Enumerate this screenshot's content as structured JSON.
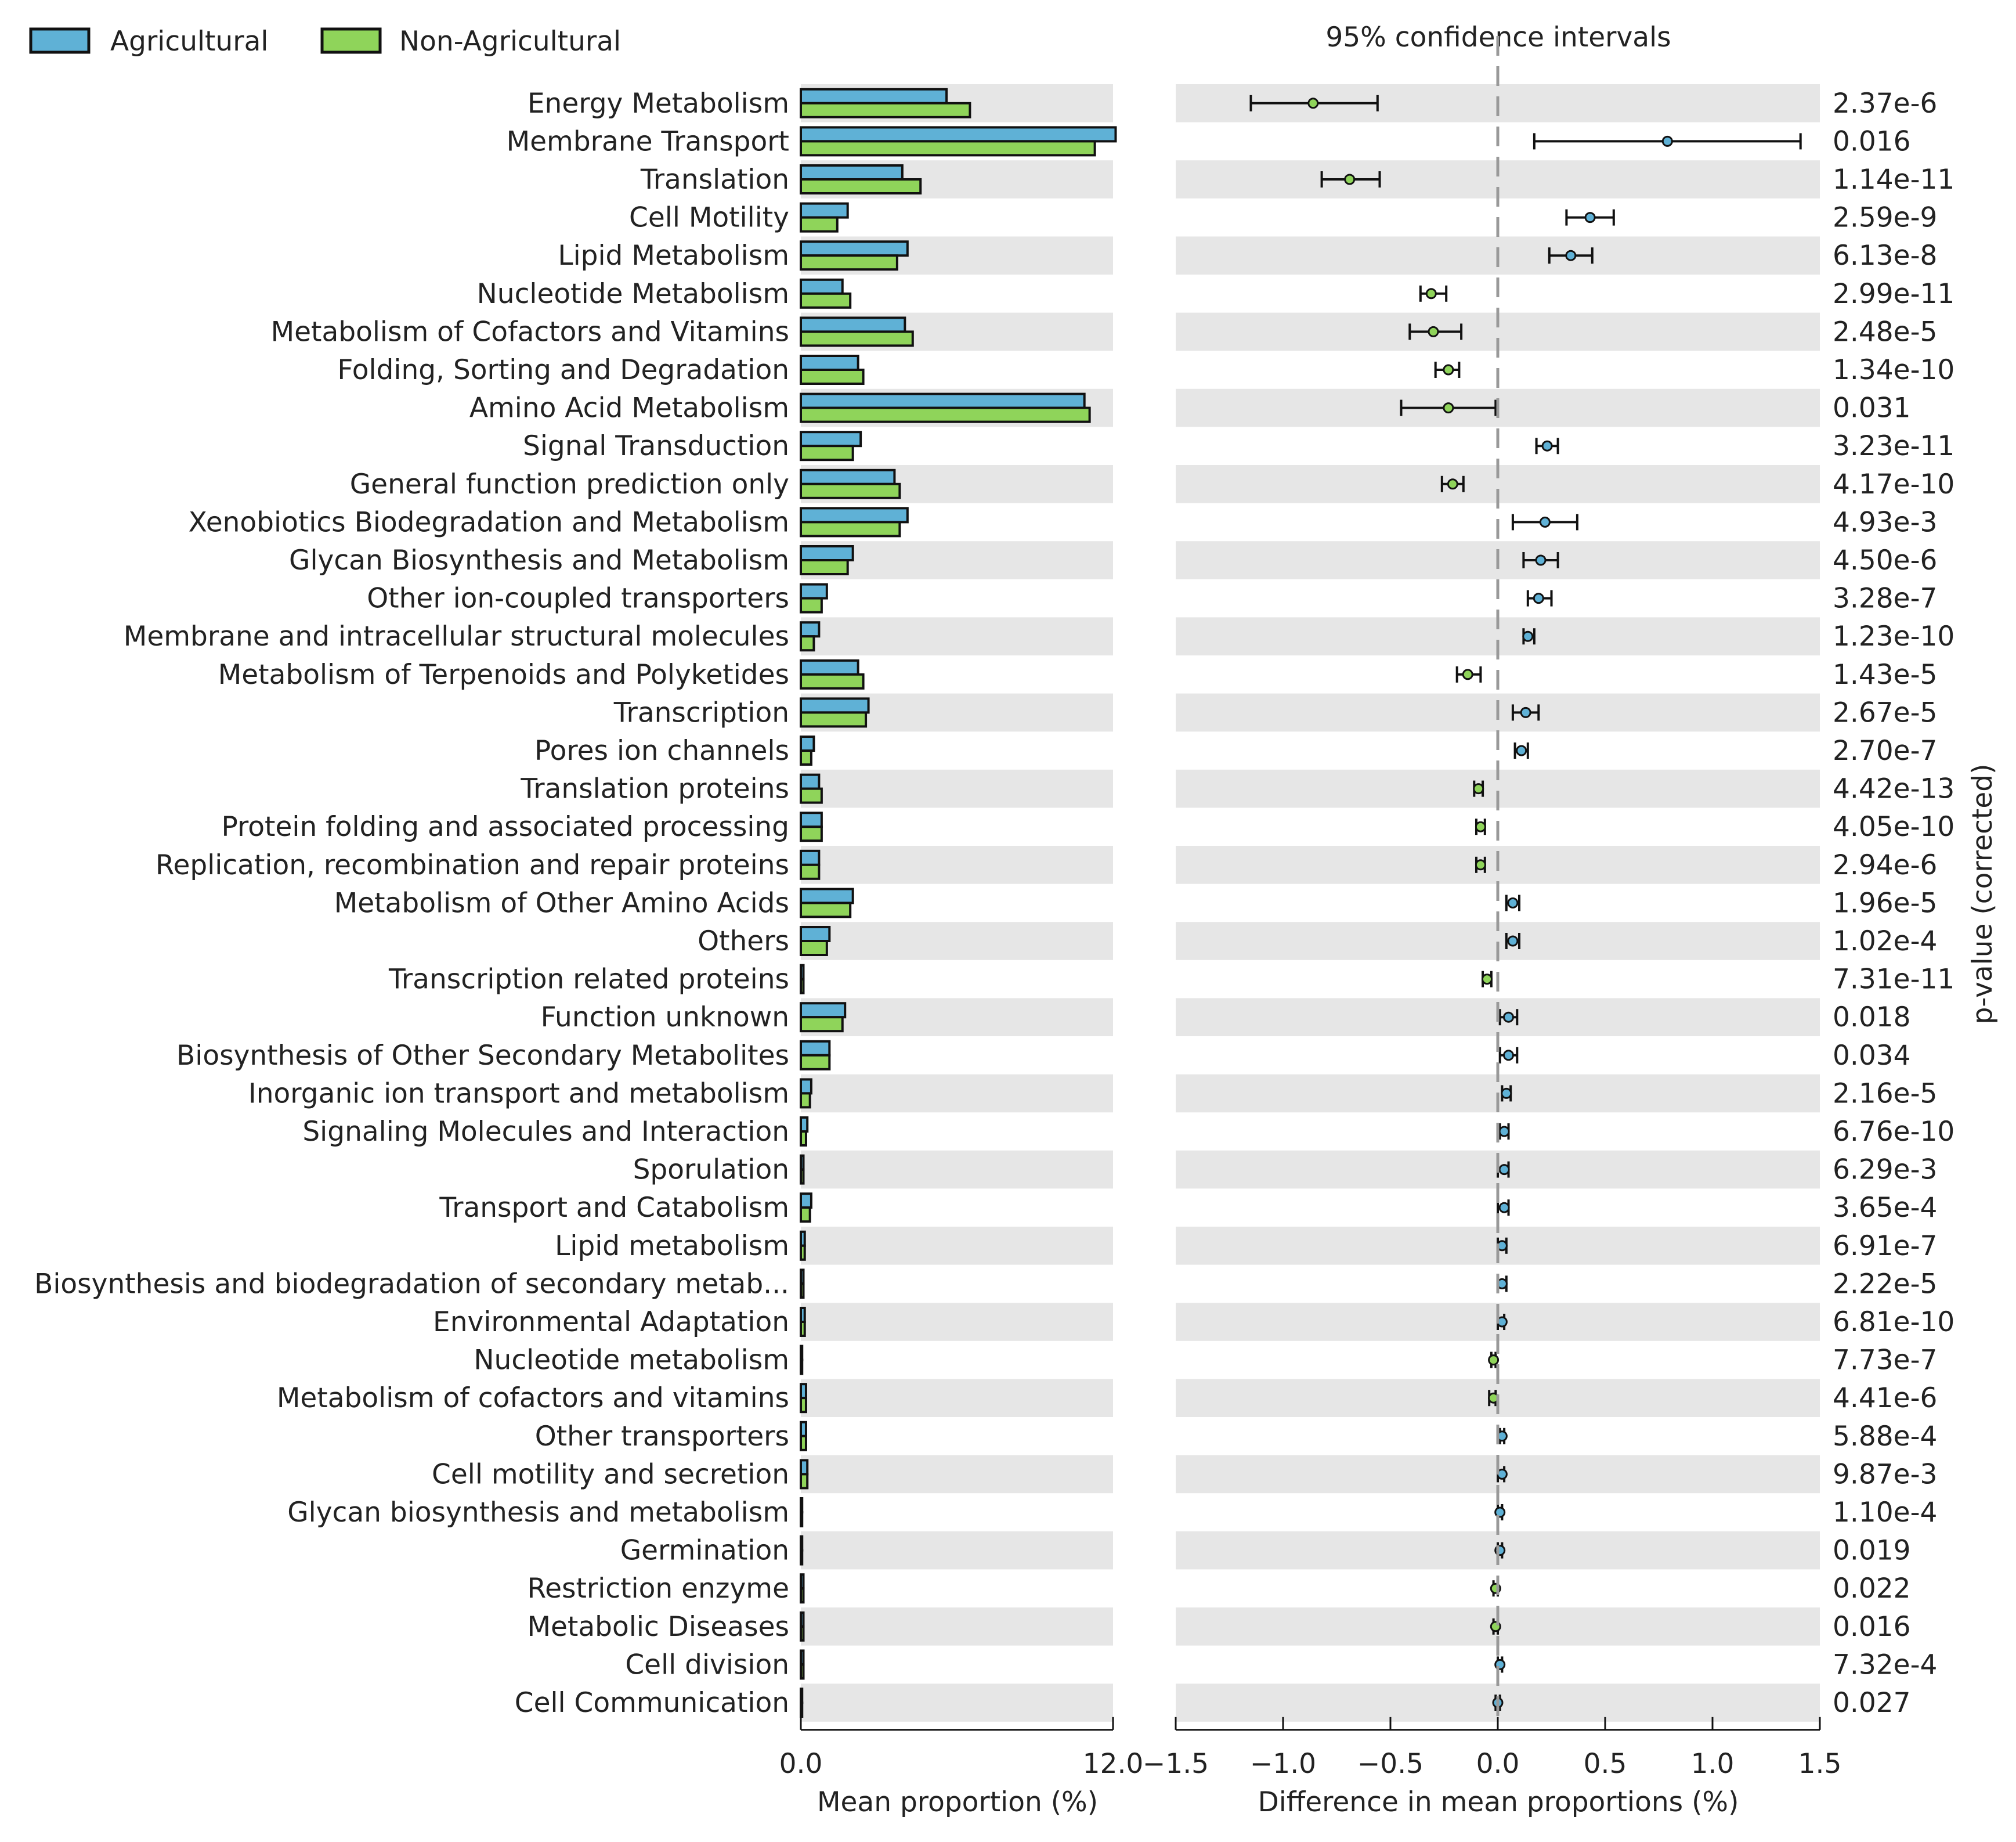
{
  "legend": [
    {
      "name": "Agricultural",
      "color": "#5fb1d6"
    },
    {
      "name": "Non-Agricultural",
      "color": "#8fd45a"
    }
  ],
  "colors": {
    "agricultural": "#5fb1d6",
    "non_agricultural": "#8fd45a",
    "stripe": "#e6e6e6",
    "zero_line": "#999999"
  },
  "chart_data": {
    "type": "bar",
    "left_panel": {
      "xlabel": "Mean proportion (%)",
      "xlim": [
        0.0,
        12.0
      ],
      "ticks": [
        "0.0",
        "12.0"
      ]
    },
    "right_panel": {
      "title": "95% confidence intervals",
      "xlabel": "Difference in mean proportions (%)",
      "xlim": [
        -1.5,
        1.5
      ],
      "ticks": [
        "−1.5",
        "−1.0",
        "−0.5",
        "0.0",
        "0.5",
        "1.0",
        "1.5"
      ],
      "ylabel_right": "p-value (corrected)"
    },
    "categories": [
      "Energy Metabolism",
      "Membrane Transport",
      "Translation",
      "Cell Motility",
      "Lipid Metabolism",
      "Nucleotide Metabolism",
      "Metabolism of Cofactors and Vitamins",
      "Folding, Sorting and Degradation",
      "Amino Acid Metabolism",
      "Signal Transduction",
      "General function prediction only",
      "Xenobiotics Biodegradation and Metabolism",
      "Glycan Biosynthesis and Metabolism",
      "Other ion-coupled transporters",
      "Membrane and intracellular structural molecules",
      "Metabolism of Terpenoids and Polyketides",
      "Transcription",
      "Pores ion channels",
      "Translation proteins",
      "Protein folding and associated processing",
      "Replication, recombination and repair proteins",
      "Metabolism of Other Amino Acids",
      "Others",
      "Transcription related proteins",
      "Function unknown",
      "Biosynthesis of Other Secondary Metabolites",
      "Inorganic ion transport and metabolism",
      "Signaling Molecules and Interaction",
      "Sporulation",
      "Transport and Catabolism",
      "Lipid metabolism",
      "Biosynthesis and biodegradation of secondary metab...",
      "Environmental Adaptation",
      "Nucleotide metabolism",
      "Metabolism of cofactors and vitamins",
      "Other transporters",
      "Cell motility and secretion",
      "Glycan biosynthesis and metabolism",
      "Germination",
      "Restriction enzyme",
      "Metabolic Diseases",
      "Cell division",
      "Cell Communication"
    ],
    "series": [
      {
        "name": "Agricultural",
        "values": [
          5.6,
          12.1,
          3.9,
          1.8,
          4.1,
          1.6,
          4.0,
          2.2,
          10.9,
          2.3,
          3.6,
          4.1,
          2.0,
          1.0,
          0.7,
          2.2,
          2.6,
          0.5,
          0.7,
          0.8,
          0.7,
          2.0,
          1.1,
          0.1,
          1.7,
          1.1,
          0.4,
          0.25,
          0.1,
          0.4,
          0.15,
          0.1,
          0.15,
          0.05,
          0.2,
          0.2,
          0.25,
          0.05,
          0.05,
          0.1,
          0.1,
          0.1,
          0.05
        ]
      },
      {
        "name": "Non-Agricultural",
        "values": [
          6.5,
          11.3,
          4.6,
          1.4,
          3.7,
          1.9,
          4.3,
          2.4,
          11.1,
          2.0,
          3.8,
          3.8,
          1.8,
          0.8,
          0.5,
          2.4,
          2.5,
          0.4,
          0.8,
          0.8,
          0.7,
          1.9,
          1.0,
          0.1,
          1.6,
          1.1,
          0.35,
          0.2,
          0.1,
          0.35,
          0.15,
          0.1,
          0.15,
          0.05,
          0.2,
          0.2,
          0.25,
          0.05,
          0.05,
          0.1,
          0.1,
          0.1,
          0.05
        ]
      }
    ],
    "difference": [
      -0.86,
      0.79,
      -0.69,
      0.43,
      0.34,
      -0.31,
      -0.3,
      -0.23,
      -0.23,
      0.23,
      -0.21,
      0.22,
      0.2,
      0.19,
      0.14,
      -0.14,
      0.13,
      0.11,
      -0.09,
      -0.08,
      -0.08,
      0.07,
      0.07,
      -0.05,
      0.05,
      0.05,
      0.04,
      0.03,
      0.03,
      0.03,
      0.02,
      0.02,
      0.02,
      -0.02,
      -0.02,
      0.02,
      0.02,
      0.01,
      0.01,
      -0.01,
      -0.01,
      0.01,
      0.0
    ],
    "ci_lower": [
      -1.15,
      0.17,
      -0.82,
      0.32,
      0.24,
      -0.36,
      -0.41,
      -0.29,
      -0.45,
      0.18,
      -0.26,
      0.07,
      0.12,
      0.14,
      0.12,
      -0.19,
      0.07,
      0.08,
      -0.11,
      -0.1,
      -0.1,
      0.04,
      0.04,
      -0.07,
      0.01,
      0.01,
      0.02,
      0.01,
      0.0,
      0.0,
      0.0,
      0.0,
      0.0,
      -0.03,
      -0.04,
      0.01,
      0.0,
      0.0,
      0.0,
      -0.02,
      -0.02,
      0.0,
      -0.01
    ],
    "ci_upper": [
      -0.56,
      1.41,
      -0.55,
      0.54,
      0.44,
      -0.24,
      -0.17,
      -0.18,
      -0.01,
      0.28,
      -0.16,
      0.37,
      0.28,
      0.25,
      0.17,
      -0.08,
      0.19,
      0.14,
      -0.07,
      -0.06,
      -0.06,
      0.1,
      0.1,
      -0.03,
      0.09,
      0.09,
      0.06,
      0.05,
      0.05,
      0.05,
      0.04,
      0.04,
      0.03,
      -0.01,
      -0.01,
      0.03,
      0.03,
      0.02,
      0.02,
      0.0,
      0.0,
      0.02,
      0.01
    ],
    "p_values": [
      "2.37e-6",
      "0.016",
      "1.14e-11",
      "2.59e-9",
      "6.13e-8",
      "2.99e-11",
      "2.48e-5",
      "1.34e-10",
      "0.031",
      "3.23e-11",
      "4.17e-10",
      "4.93e-3",
      "4.50e-6",
      "3.28e-7",
      "1.23e-10",
      "1.43e-5",
      "2.67e-5",
      "2.70e-7",
      "4.42e-13",
      "4.05e-10",
      "2.94e-6",
      "1.96e-5",
      "1.02e-4",
      "7.31e-11",
      "0.018",
      "0.034",
      "2.16e-5",
      "6.76e-10",
      "6.29e-3",
      "3.65e-4",
      "6.91e-7",
      "2.22e-5",
      "6.81e-10",
      "7.73e-7",
      "4.41e-6",
      "5.88e-4",
      "9.87e-3",
      "1.10e-4",
      "0.019",
      "0.022",
      "0.016",
      "7.32e-4",
      "0.027"
    ],
    "grid": false,
    "legend_position": "top-left"
  }
}
